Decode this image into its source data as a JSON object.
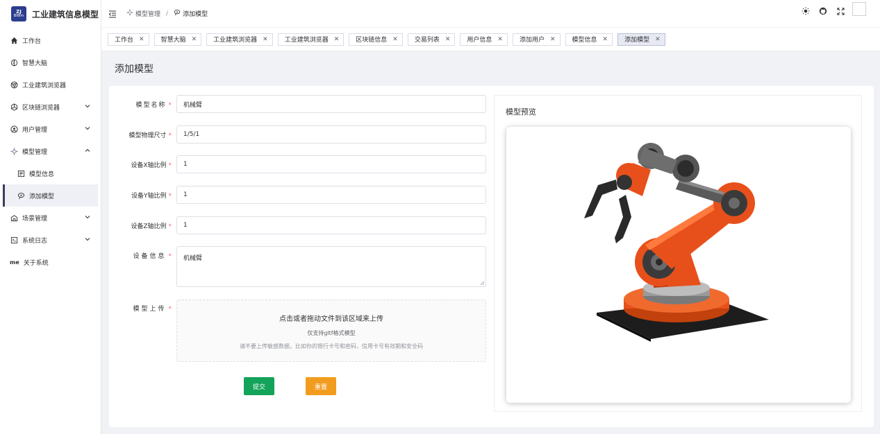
{
  "app": {
    "logo_top": "ZJ",
    "logo_sub": "BIBim",
    "title": "工业建筑信息模型"
  },
  "sidebar": {
    "items": [
      {
        "label": "工作台",
        "icon": "home-icon"
      },
      {
        "label": "智慧大脑",
        "icon": "brain-icon"
      },
      {
        "label": "工业建筑浏览器",
        "icon": "chrome-icon"
      },
      {
        "label": "区块链浏览器",
        "icon": "blockchain-icon"
      },
      {
        "label": "用户管理",
        "icon": "user-circle-icon"
      },
      {
        "label": "模型管理",
        "icon": "model-icon"
      },
      {
        "label": "模型信息",
        "icon": "model-info-icon"
      },
      {
        "label": "添加模型",
        "icon": "add-model-icon"
      },
      {
        "label": "场景管理",
        "icon": "scene-icon"
      },
      {
        "label": "系统日志",
        "icon": "log-icon"
      },
      {
        "label": "关于系统",
        "icon": "me-icon",
        "icon_text": "me"
      }
    ]
  },
  "header": {
    "breadcrumb": [
      "模型管理",
      "添加模型"
    ],
    "separator": "/"
  },
  "tags": [
    "工作台",
    "智慧大脑",
    "工业建筑浏览器",
    "工业建筑浏览器",
    "区块链信息",
    "交易列表",
    "用户信息",
    "添加用户",
    "模型信息",
    "添加模型"
  ],
  "page": {
    "title": "添加模型"
  },
  "form": {
    "required_mark": "*",
    "model_name": {
      "label": "模型名称",
      "value": "机械臂"
    },
    "physical_size": {
      "label": "模型物理尺寸",
      "value": "1/5/1"
    },
    "x_scale": {
      "label": "设备X轴比例",
      "value": "1"
    },
    "y_scale": {
      "label": "设备Y轴比例",
      "value": "1"
    },
    "z_scale": {
      "label": "设备Z轴比例",
      "value": "1"
    },
    "device_info": {
      "label": "设备信息",
      "value": "机械臂"
    },
    "upload": {
      "label": "模型上传",
      "main_text": "点击或者拖动文件到该区域来上传",
      "hint": "仅支持gltf格式模型",
      "warning": "请不要上传敏感数据，比如你的银行卡号和密码，信用卡号有效期和安全码"
    },
    "submit_label": "提交",
    "reset_label": "重置"
  },
  "preview": {
    "title": "模型预览"
  },
  "colors": {
    "accent": "#2c3e8f",
    "submit": "#13a35a",
    "reset": "#f29c1f",
    "robot": "#e8501b"
  }
}
